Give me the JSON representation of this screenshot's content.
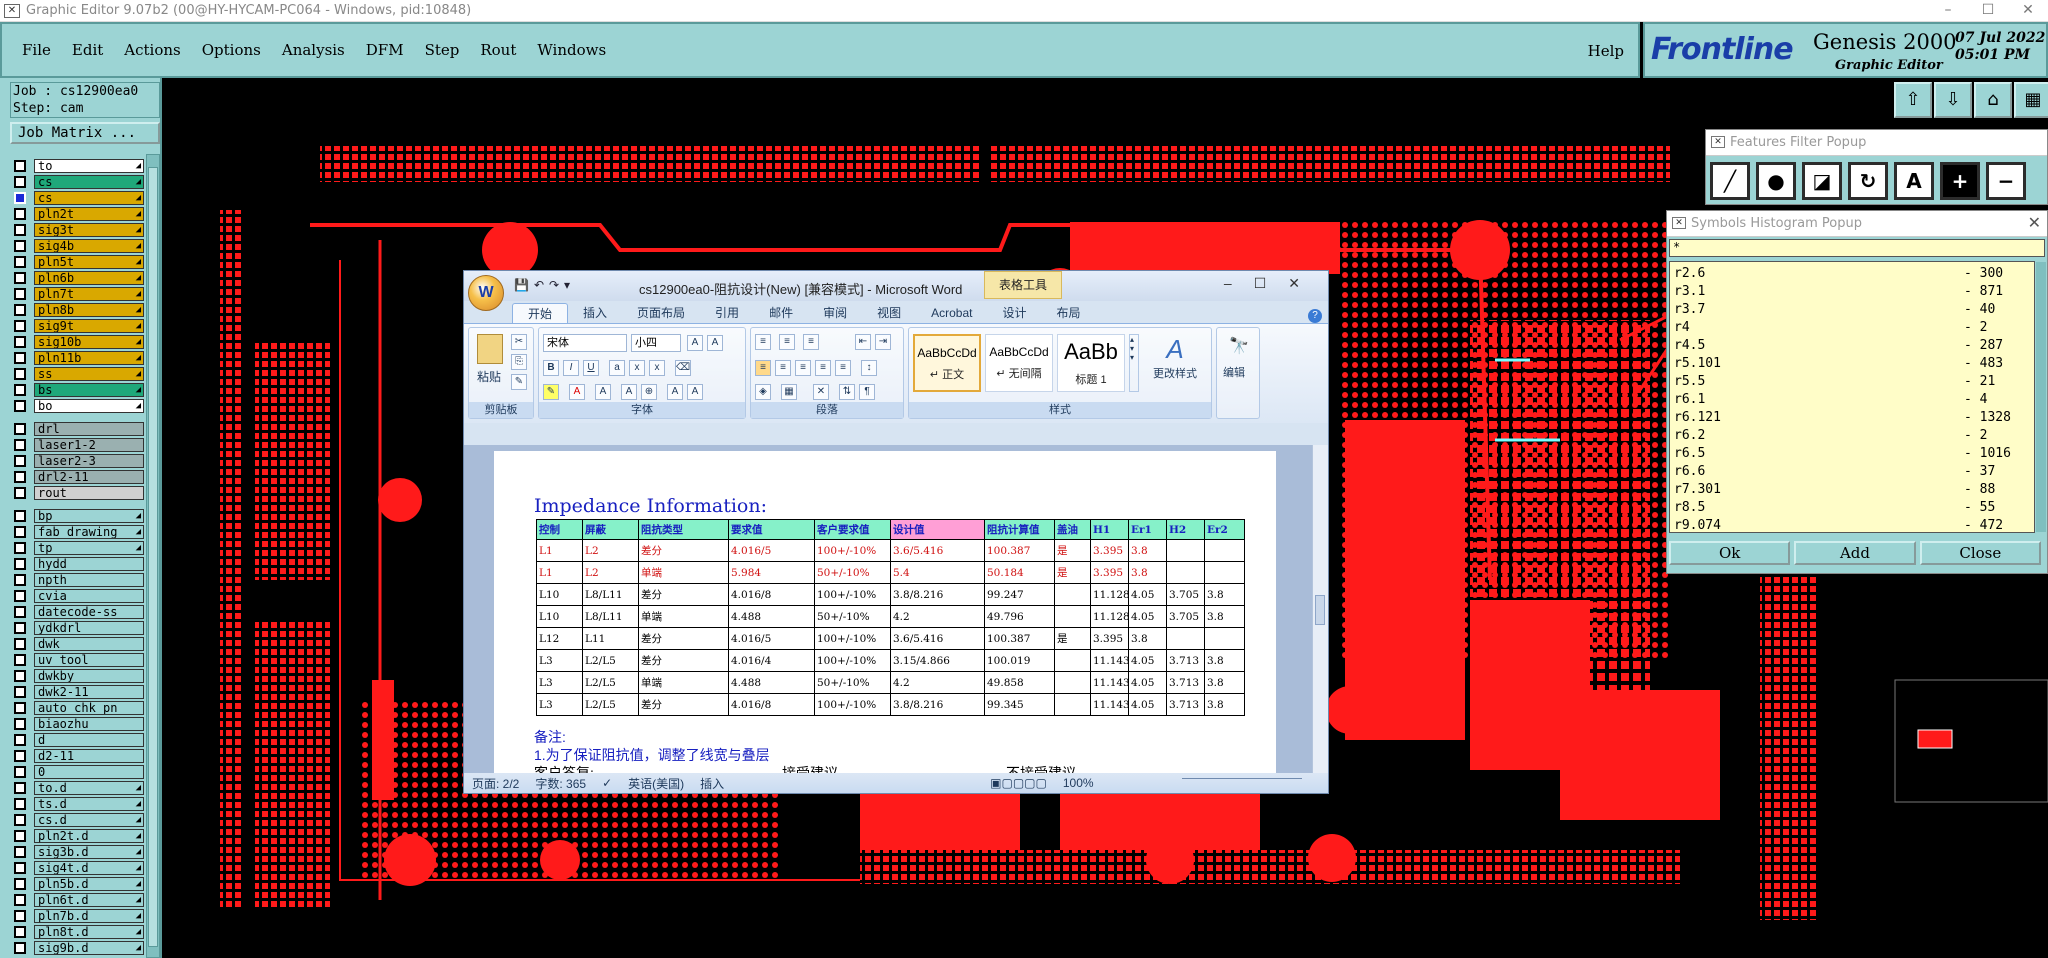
{
  "app": {
    "title": "Graphic Editor 9.07b2 (00@HY-HYCAM-PC064 - Windows, pid:10848)"
  },
  "menu": {
    "items": [
      "File",
      "Edit",
      "Actions",
      "Options",
      "Analysis",
      "DFM",
      "Step",
      "Rout",
      "Windows"
    ],
    "help": "Help"
  },
  "logo": {
    "brand": "Frontline",
    "product": "Genesis 2000",
    "subtitle": "Graphic Editor",
    "date": "07 Jul 2022",
    "time": "05:01 PM"
  },
  "job": {
    "job_line": "Job : cs12900ea0",
    "step_line": "Step: cam",
    "matrix_button": "Job Matrix ..."
  },
  "layers": [
    {
      "name": "to",
      "color": "#ffffff",
      "mark": "◢"
    },
    {
      "name": "cs",
      "color": "#1fa87a",
      "mark": "◢"
    },
    {
      "name": "cs",
      "color": "#d9a800",
      "mark": "◢"
    },
    {
      "name": "pln2t",
      "color": "#d9a800",
      "mark": "◢"
    },
    {
      "name": "sig3t",
      "color": "#d9a800",
      "mark": "◢"
    },
    {
      "name": "sig4b",
      "color": "#d9a800",
      "mark": "◢"
    },
    {
      "name": "pln5t",
      "color": "#d9a800",
      "mark": "◢"
    },
    {
      "name": "pln6b",
      "color": "#d9a800",
      "mark": "◢"
    },
    {
      "name": "pln7t",
      "color": "#d9a800",
      "mark": "◢"
    },
    {
      "name": "pln8b",
      "color": "#d9a800",
      "mark": "◢"
    },
    {
      "name": "sig9t",
      "color": "#d9a800",
      "mark": "◢"
    },
    {
      "name": "sig10b",
      "color": "#d9a800",
      "mark": "◢"
    },
    {
      "name": "pln11b",
      "color": "#d9a800",
      "mark": "◢"
    },
    {
      "name": "ss",
      "color": "#d9a800",
      "mark": "◢"
    },
    {
      "name": "bs",
      "color": "#1fa87a",
      "mark": "◢"
    },
    {
      "name": "bo",
      "color": "#ffffff",
      "mark": "◢"
    },
    {
      "name": "drl",
      "color": "#9ab0b0",
      "mark": "",
      "gap": true
    },
    {
      "name": "laser1-2",
      "color": "#9ab0b0",
      "mark": ""
    },
    {
      "name": "laser2-3",
      "color": "#9ab0b0",
      "mark": ""
    },
    {
      "name": "drl2-11",
      "color": "#9ab0b0",
      "mark": ""
    },
    {
      "name": "rout",
      "color": "#d0d0d0",
      "mark": ""
    },
    {
      "name": "bp",
      "color": "#9cd4d4",
      "mark": "◢",
      "gap": true
    },
    {
      "name": "fab_drawing",
      "color": "#9cd4d4",
      "mark": "◢"
    },
    {
      "name": "tp",
      "color": "#9cd4d4",
      "mark": "◢"
    },
    {
      "name": "hydd",
      "color": "#9cd4d4",
      "mark": ""
    },
    {
      "name": "npth",
      "color": "#9cd4d4",
      "mark": ""
    },
    {
      "name": "cvia",
      "color": "#9cd4d4",
      "mark": ""
    },
    {
      "name": "datecode-ss",
      "color": "#9cd4d4",
      "mark": ""
    },
    {
      "name": "ydkdrl",
      "color": "#9cd4d4",
      "mark": ""
    },
    {
      "name": "dwk",
      "color": "#9cd4d4",
      "mark": ""
    },
    {
      "name": "uv_tool",
      "color": "#9cd4d4",
      "mark": ""
    },
    {
      "name": "dwkby",
      "color": "#9cd4d4",
      "mark": ""
    },
    {
      "name": "dwk2-11",
      "color": "#9cd4d4",
      "mark": ""
    },
    {
      "name": "auto_chk_pn",
      "color": "#9cd4d4",
      "mark": ""
    },
    {
      "name": "biaozhu",
      "color": "#9cd4d4",
      "mark": ""
    },
    {
      "name": "d",
      "color": "#9cd4d4",
      "mark": ""
    },
    {
      "name": "d2-11",
      "color": "#9cd4d4",
      "mark": ""
    },
    {
      "name": "0",
      "color": "#9cd4d4",
      "mark": ""
    },
    {
      "name": "to.d",
      "color": "#9cd4d4",
      "mark": "◢"
    },
    {
      "name": "ts.d",
      "color": "#9cd4d4",
      "mark": "◢"
    },
    {
      "name": "cs.d",
      "color": "#9cd4d4",
      "mark": "◢"
    },
    {
      "name": "pln2t.d",
      "color": "#9cd4d4",
      "mark": "◢"
    },
    {
      "name": "sig3b.d",
      "color": "#9cd4d4",
      "mark": "◢"
    },
    {
      "name": "sig4t.d",
      "color": "#9cd4d4",
      "mark": "◢"
    },
    {
      "name": "pln5b.d",
      "color": "#9cd4d4",
      "mark": "◢"
    },
    {
      "name": "pln6t.d",
      "color": "#9cd4d4",
      "mark": "◢"
    },
    {
      "name": "pln7b.d",
      "color": "#9cd4d4",
      "mark": "◢"
    },
    {
      "name": "pln8t.d",
      "color": "#9cd4d4",
      "mark": "◢"
    },
    {
      "name": "sig9b.d",
      "color": "#9cd4d4",
      "mark": "◢"
    }
  ],
  "features_filter": {
    "title": "Features Filter Popup",
    "tools": [
      "╱",
      "●",
      "◪",
      "↻",
      "A",
      "+",
      "−"
    ]
  },
  "symbols_histogram": {
    "title": "Symbols Histogram Popup",
    "filter": "*",
    "rows": [
      {
        "symbol": "r2.6",
        "count": "- 300"
      },
      {
        "symbol": "r3.1",
        "count": "- 871"
      },
      {
        "symbol": "r3.7",
        "count": "- 40"
      },
      {
        "symbol": "r4",
        "count": "- 2"
      },
      {
        "symbol": "r4.5",
        "count": "- 287"
      },
      {
        "symbol": "r5.101",
        "count": "- 483"
      },
      {
        "symbol": "r5.5",
        "count": "- 21"
      },
      {
        "symbol": "r6.1",
        "count": "- 4"
      },
      {
        "symbol": "r6.121",
        "count": "- 1328"
      },
      {
        "symbol": "r6.2",
        "count": "- 2"
      },
      {
        "symbol": "r6.5",
        "count": "- 1016"
      },
      {
        "symbol": "r6.6",
        "count": "- 37"
      },
      {
        "symbol": "r7.301",
        "count": "- 88"
      },
      {
        "symbol": "r8.5",
        "count": "- 55"
      },
      {
        "symbol": "r9.074",
        "count": "- 472"
      }
    ],
    "ok": "Ok",
    "add": "Add",
    "close": "Close"
  },
  "word": {
    "doc_title": "cs12900ea0-阻抗设计(New) [兼容模式] - Microsoft Word",
    "context_tab": "表格工具",
    "tabs": [
      "开始",
      "插入",
      "页面布局",
      "引用",
      "邮件",
      "审阅",
      "视图",
      "Acrobat",
      "设计",
      "布局"
    ],
    "groups": {
      "clipboard": "剪贴板",
      "font": "字体",
      "paragraph": "段落",
      "styles": "样式",
      "editing": "编辑"
    },
    "paste": "粘贴",
    "font_name": "宋体",
    "font_size": "小四",
    "styles": [
      {
        "preview": "AaBbCcDd",
        "name": "↵ 正文"
      },
      {
        "preview": "AaBbCcDd",
        "name": "↵ 无间隔"
      },
      {
        "preview": "AaBb",
        "name": "标题 1"
      }
    ],
    "change_styles": "更改样式",
    "edit_label": "编辑",
    "impedance_title": "Impedance Information:",
    "table_headers": [
      "控制",
      "屏蔽",
      "阻抗类型",
      "要求值",
      "客户要求值",
      "设计值",
      "阻抗计算值",
      "盖油",
      "H1",
      "Er1",
      "H2",
      "Er2"
    ],
    "table_rows": [
      [
        "L1",
        "L2",
        "差分",
        "4.016/5",
        "100+/-10%",
        "3.6/5.416",
        "100.387",
        "是",
        "3.395",
        "3.8",
        "",
        ""
      ],
      [
        "L1",
        "L2",
        "单端",
        "5.984",
        "50+/-10%",
        "5.4",
        "50.184",
        "是",
        "3.395",
        "3.8",
        "",
        ""
      ],
      [
        "L10",
        "L8/L11",
        "差分",
        "4.016/8",
        "100+/-10%",
        "3.8/8.216",
        "99.247",
        "",
        "11.128",
        "4.05",
        "3.705",
        "3.8"
      ],
      [
        "L10",
        "L8/L11",
        "单端",
        "4.488",
        "50+/-10%",
        "4.2",
        "49.796",
        "",
        "11.128",
        "4.05",
        "3.705",
        "3.8"
      ],
      [
        "L12",
        "L11",
        "差分",
        "4.016/5",
        "100+/-10%",
        "3.6/5.416",
        "100.387",
        "是",
        "3.395",
        "3.8",
        "",
        ""
      ],
      [
        "L3",
        "L2/L5",
        "差分",
        "4.016/4",
        "100+/-10%",
        "3.15/4.866",
        "100.019",
        "",
        "11.143",
        "4.05",
        "3.713",
        "3.8"
      ],
      [
        "L3",
        "L2/L5",
        "单端",
        "4.488",
        "50+/-10%",
        "4.2",
        "49.858",
        "",
        "11.143",
        "4.05",
        "3.713",
        "3.8"
      ],
      [
        "L3",
        "L2/L5",
        "差分",
        "4.016/8",
        "100+/-10%",
        "3.8/8.216",
        "99.345",
        "",
        "11.143",
        "4.05",
        "3.713",
        "3.8"
      ]
    ],
    "note_label": "备注:",
    "note_1": "1.为了保证阻抗值，调整了线宽与叠层",
    "customer_reply": "客户答复:",
    "accept": "接受建议",
    "reject": "不接受建议",
    "status": {
      "page": "页面: 2/2",
      "words": "字数: 365",
      "lang": "英语(美国)",
      "mode": "插入",
      "zoom": "100%"
    }
  }
}
